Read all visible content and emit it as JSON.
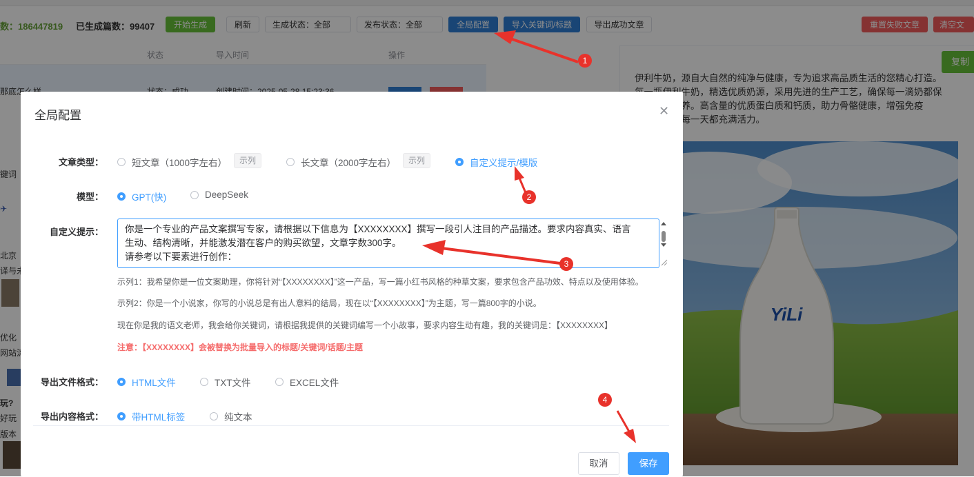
{
  "toolbar": {
    "total_label": "数：",
    "total_value": "186447819",
    "generated_label": "已生成篇数：",
    "generated_value": "99407",
    "start_button": "开始生成",
    "refresh_button": "刷新",
    "gen_status_select": "生成状态：全部",
    "pub_status_select": "发布状态：全部",
    "global_config_button": "全局配置",
    "import_button": "导入关键词/标题",
    "export_button": "导出成功文章",
    "reset_failed_button": "重置失败文章",
    "clear_button": "清空文"
  },
  "table": {
    "headers": [
      "状态",
      "导入时间",
      "操作"
    ],
    "row_fragment": "那底怎么样",
    "row_status": "状态：成功",
    "row_time": "创建时间：2025-05-28 15:23:36"
  },
  "left_fragments": [
    "键词",
    "北京",
    "译与未",
    "优化",
    "网站流",
    "玩?",
    "好玩",
    "版本"
  ],
  "right_panel": {
    "copy_button": "复制",
    "article_lines": [
      "伊利牛奶，源自大自然的纯净与健康，专为追求高品质生活的您精心打造。",
      "每一瓶伊利牛奶，精选优质奶源，采用先进的生产工艺，确保每一滴奶都保",
      "留天然的营养。高含量的优质蛋白质和钙质，助力骨骼健康，增强免疫",
      "力，让您的每一天都充满活力。"
    ],
    "bottle_brand": "YiLi"
  },
  "modal": {
    "title": "全局配置",
    "article_type": {
      "label": "文章类型：",
      "options": [
        "短文章（1000字左右）",
        "长文章（2000字左右）",
        "自定义提示/模版"
      ],
      "example_tag": "示列",
      "selected": 2
    },
    "model": {
      "label": "模型：",
      "options": [
        "GPT(快)",
        "DeepSeek"
      ],
      "selected": 0
    },
    "custom_prompt": {
      "label": "自定义提示：",
      "lines": [
        "你是一个专业的产品文案撰写专家，请根据以下信息为【XXXXXXXX】撰写一段引人注目的产品描述。要求内容真实、语言",
        "生动、结构清晰，并能激发潜在客户的购买欲望，文章字数300字。",
        "请参考以下要素进行创作："
      ]
    },
    "hints": [
      "示列1：我希望你是一位文案助理，你将针对“【XXXXXXXX】”这一产品，写一篇小红书风格的种草文案，要求包含产品功效、特点以及使用体验。",
      "示列2：你是一个小说家，你写的小说总是有出人意料的结局，现在以“【XXXXXXXX】”为主题，写一篇800字的小说。",
      "现在你是我的语文老师，我会给你关键词，请根据我提供的关键词编写一个小故事，要求内容生动有趣，我的关键词是：【XXXXXXXX】"
    ],
    "warning": "注意：【XXXXXXXX】会被替换为批量导入的标题/关键词/话题/主题",
    "export_format": {
      "label": "导出文件格式：",
      "options": [
        "HTML文件",
        "TXT文件",
        "EXCEL文件"
      ],
      "selected": 0
    },
    "content_format": {
      "label": "导出内容格式：",
      "options": [
        "带HTML标签",
        "纯文本"
      ],
      "selected": 0
    },
    "cancel_button": "取消",
    "save_button": "保存"
  },
  "annotations": [
    "1",
    "2",
    "3",
    "4"
  ],
  "colors": {
    "primary": "#409eff",
    "green": "#67c23a",
    "danger": "#f56c6c",
    "annotation_red": "#e8322b"
  }
}
